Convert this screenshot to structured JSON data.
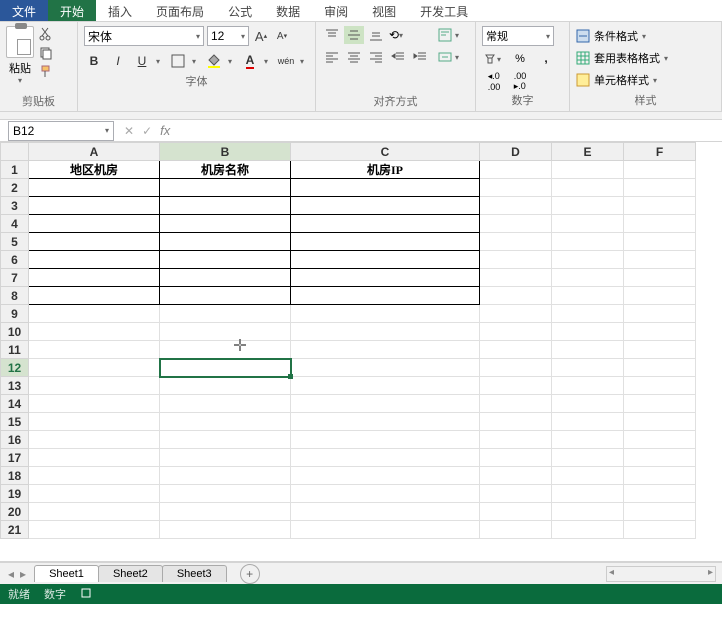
{
  "menu": {
    "file": "文件",
    "home": "开始",
    "insert": "插入",
    "layout": "页面布局",
    "formulas": "公式",
    "data": "数据",
    "review": "审阅",
    "view": "视图",
    "dev": "开发工具"
  },
  "ribbon": {
    "clipboard": {
      "paste": "粘贴",
      "label": "剪贴板"
    },
    "font": {
      "name": "宋体",
      "size": "12",
      "label": "字体",
      "bold": "B",
      "italic": "I",
      "underline": "U",
      "pinyin": "wén",
      "grow": "A",
      "shrink": "A"
    },
    "align": {
      "label": "对齐方式"
    },
    "number": {
      "format": "常规",
      "label": "数字",
      "pct": "%",
      "comma": ",",
      "inc": ".0",
      "dec": ".00"
    },
    "styles": {
      "cond": "条件格式",
      "tbl": "套用表格格式",
      "cell": "单元格样式",
      "label": "样式"
    }
  },
  "fbar": {
    "namebox": "B12",
    "cancel": "✕",
    "confirm": "✓",
    "fx": "fx"
  },
  "grid": {
    "cols": [
      "A",
      "B",
      "C",
      "D",
      "E",
      "F"
    ],
    "headers": {
      "a1": "地区机房",
      "b1": "机房名称",
      "c1": "机房IP"
    },
    "selected_cell": "B12",
    "rows_shown": 21
  },
  "tabs": {
    "s1": "Sheet1",
    "s2": "Sheet2",
    "s3": "Sheet3",
    "add": "+"
  },
  "status": {
    "ready": "就绪",
    "num": "数字"
  }
}
